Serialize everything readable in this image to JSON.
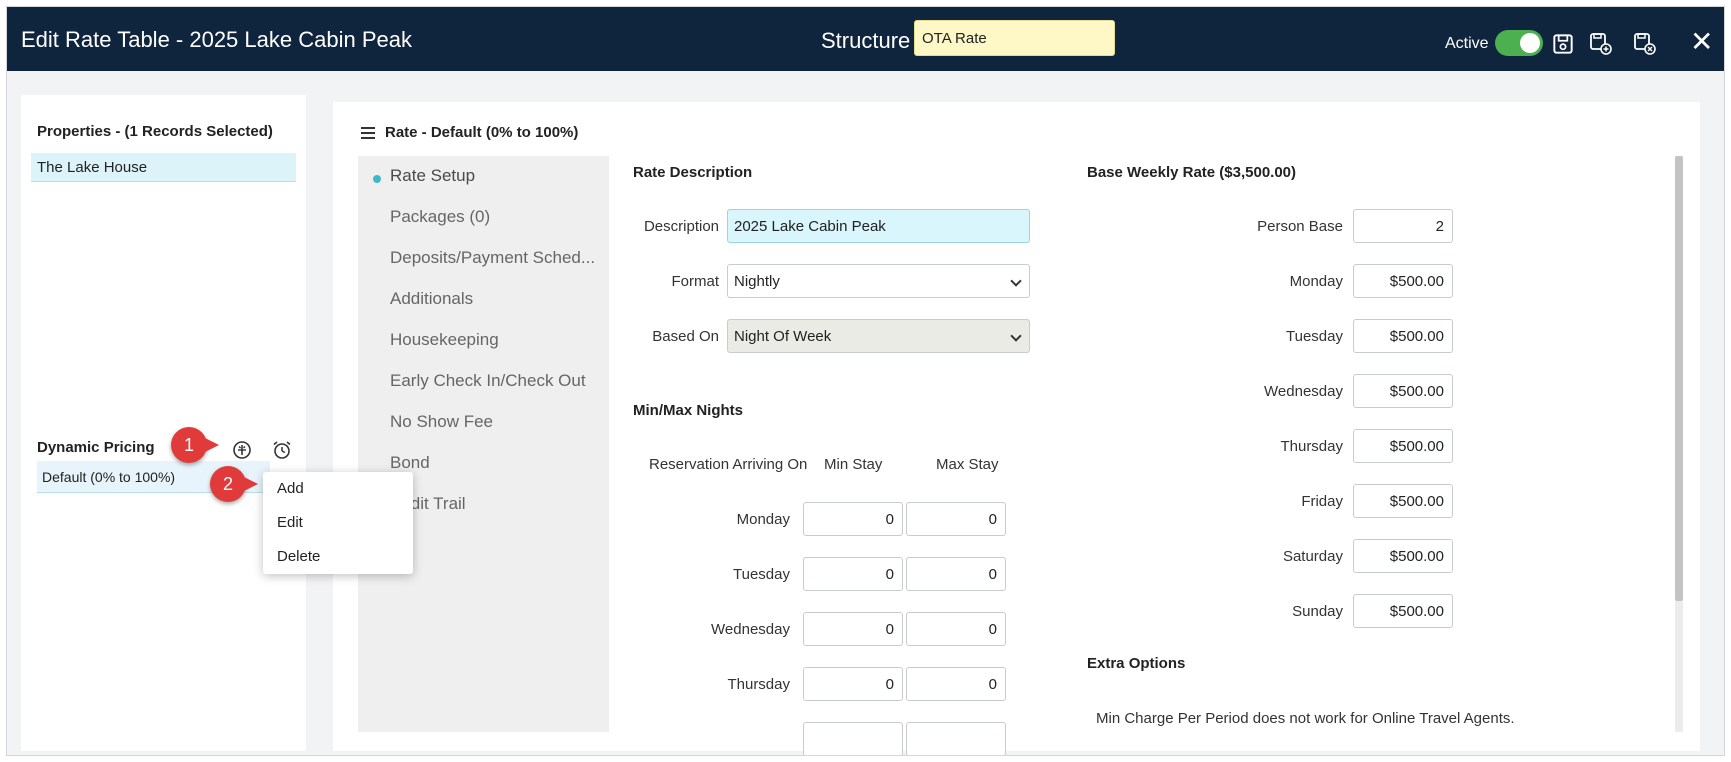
{
  "header": {
    "title": "Edit Rate Table - 2025 Lake Cabin Peak",
    "structure_label": "Structure",
    "structure_value": "OTA Rate",
    "active_label": "Active",
    "active_on": true,
    "icons": [
      "save-icon",
      "save-new-icon",
      "save-close-icon",
      "close-icon"
    ],
    "close_glyph": "✕"
  },
  "left": {
    "properties_title": "Properties - (1 Records Selected)",
    "properties_items": [
      "The Lake House"
    ],
    "dynamic_pricing_title": "Dynamic Pricing",
    "dynamic_pricing_items": [
      "Default (0% to 100%)"
    ],
    "callouts": [
      "1",
      "2"
    ],
    "context_menu": [
      "Add",
      "Edit",
      "Delete"
    ]
  },
  "main": {
    "rate_header": "Rate - Default (0% to 100%)",
    "nav": [
      "Rate Setup",
      "Packages (0)",
      "Deposits/Payment Sched...",
      "Additionals",
      "Housekeeping",
      "Early Check In/Check Out",
      "No Show Fee",
      "Bond",
      "Audit Trail"
    ],
    "rate_description": {
      "heading": "Rate Description",
      "description_label": "Description",
      "description_value": "2025 Lake Cabin Peak",
      "format_label": "Format",
      "format_value": "Nightly",
      "based_on_label": "Based On",
      "based_on_value": "Night Of Week"
    },
    "min_max": {
      "heading": "Min/Max Nights",
      "col_arriving": "Reservation Arriving On",
      "col_min": "Min Stay",
      "col_max": "Max Stay",
      "rows": [
        {
          "day": "Monday",
          "min": "0",
          "max": "0"
        },
        {
          "day": "Tuesday",
          "min": "0",
          "max": "0"
        },
        {
          "day": "Wednesday",
          "min": "0",
          "max": "0"
        },
        {
          "day": "Thursday",
          "min": "0",
          "max": "0"
        }
      ]
    },
    "base_weekly": {
      "heading": "Base Weekly Rate ($3,500.00)",
      "person_base_label": "Person Base",
      "person_base_value": "2",
      "rows": [
        {
          "day": "Monday",
          "value": "$500.00"
        },
        {
          "day": "Tuesday",
          "value": "$500.00"
        },
        {
          "day": "Wednesday",
          "value": "$500.00"
        },
        {
          "day": "Thursday",
          "value": "$500.00"
        },
        {
          "day": "Friday",
          "value": "$500.00"
        },
        {
          "day": "Saturday",
          "value": "$500.00"
        },
        {
          "day": "Sunday",
          "value": "$500.00"
        }
      ]
    },
    "extra_options": {
      "heading": "Extra Options",
      "note": "Min Charge Per Period does not work for Online Travel Agents."
    }
  },
  "colors": {
    "header_bg": "#0f243d",
    "structure_bg": "#fef8c6",
    "toggle_on": "#4caf50",
    "callout_red": "#e13a3a",
    "selected_row": "#ddf3fa",
    "active_dot": "#3fb8c8"
  }
}
